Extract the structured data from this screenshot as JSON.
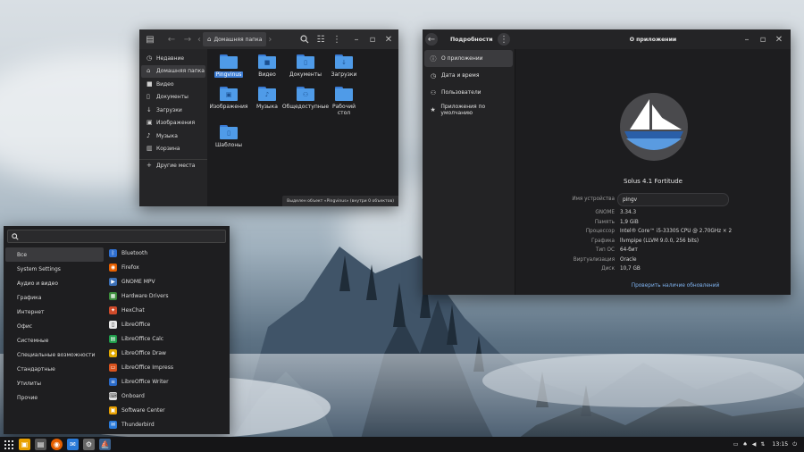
{
  "file_manager": {
    "path_label": "Домашняя папка",
    "sidebar": [
      {
        "icon": "clock-icon",
        "label": "Недавние"
      },
      {
        "icon": "home-icon",
        "label": "Домашняя папка"
      },
      {
        "icon": "video-icon",
        "label": "Видео"
      },
      {
        "icon": "document-icon",
        "label": "Документы"
      },
      {
        "icon": "download-icon",
        "label": "Загрузки"
      },
      {
        "icon": "image-icon",
        "label": "Изображения"
      },
      {
        "icon": "music-icon",
        "label": "Музыка"
      },
      {
        "icon": "trash-icon",
        "label": "Корзина"
      },
      {
        "icon": "plus-icon",
        "label": "Другие места"
      }
    ],
    "folders": [
      {
        "label": "Pingvinus",
        "icon": "folder-icon"
      },
      {
        "label": "Видео",
        "icon": "folder-video-icon"
      },
      {
        "label": "Документы",
        "icon": "folder-document-icon"
      },
      {
        "label": "Загрузки",
        "icon": "folder-download-icon"
      },
      {
        "label": "Изображения",
        "icon": "folder-image-icon"
      },
      {
        "label": "Музыка",
        "icon": "folder-music-icon"
      },
      {
        "label": "Общедоступные",
        "icon": "folder-public-icon"
      },
      {
        "label": "Рабочий стол",
        "icon": "folder-desktop-icon"
      },
      {
        "label": "Шаблоны",
        "icon": "folder-templates-icon"
      }
    ],
    "status": "Выделен объект «Pingvinus» (внутри 0 объектов)"
  },
  "about": {
    "sidebar_title": "Подробности",
    "title": "О приложении",
    "sidebar": [
      {
        "icon": "info-icon",
        "label": "О приложении"
      },
      {
        "icon": "clock-icon",
        "label": "Дата и время"
      },
      {
        "icon": "users-icon",
        "label": "Пользователи"
      },
      {
        "icon": "star-icon",
        "label": "Приложения по умолчанию"
      }
    ],
    "os_name": "Solus 4.1 Fortitude",
    "device_label": "Имя устройства",
    "device_value": "pingv",
    "details": [
      {
        "key": "GNOME",
        "value": "3.34.3"
      },
      {
        "key": "Память",
        "value": "1,9 GiB"
      },
      {
        "key": "Процессор",
        "value": "Intel® Core™ i5-3330S CPU @ 2.70GHz × 2"
      },
      {
        "key": "Графика",
        "value": "llvmpipe (LLVM 9.0.0, 256 bits)"
      },
      {
        "key": "Тип ОС",
        "value": "64-бит"
      },
      {
        "key": "Виртуализация",
        "value": "Oracle"
      },
      {
        "key": "Диск",
        "value": "10,7 GB"
      }
    ],
    "update_link": "Проверить наличие обновлений"
  },
  "menu": {
    "categories": [
      "Все",
      "System Settings",
      "Аудио и видео",
      "Графика",
      "Интернет",
      "Офис",
      "Системные",
      "Специальные возможности",
      "Стандартные",
      "Утилиты",
      "Прочие"
    ],
    "apps": [
      {
        "label": "Bluetooth",
        "icon": "bluetooth-icon",
        "color": "#2f6fd0",
        "glyph": "ᛒ"
      },
      {
        "label": "Firefox",
        "icon": "firefox-icon",
        "color": "#e66000",
        "glyph": "◉"
      },
      {
        "label": "GNOME MPV",
        "icon": "mpv-icon",
        "color": "#3b6fb6",
        "glyph": "▶"
      },
      {
        "label": "Hardware Drivers",
        "icon": "drivers-icon",
        "color": "#3c8d3c",
        "glyph": "▦"
      },
      {
        "label": "HexChat",
        "icon": "hexchat-icon",
        "color": "#d04b2a",
        "glyph": "✦"
      },
      {
        "label": "LibreOffice",
        "icon": "libreoffice-icon",
        "color": "#e8e8e8",
        "glyph": "▯"
      },
      {
        "label": "LibreOffice Calc",
        "icon": "calc-icon",
        "color": "#1f9c4a",
        "glyph": "▤"
      },
      {
        "label": "LibreOffice Draw",
        "icon": "draw-icon",
        "color": "#e0a800",
        "glyph": "◆"
      },
      {
        "label": "LibreOffice Impress",
        "icon": "impress-icon",
        "color": "#d9531e",
        "glyph": "▭"
      },
      {
        "label": "LibreOffice Writer",
        "icon": "writer-icon",
        "color": "#2a6ac8",
        "glyph": "≡"
      },
      {
        "label": "Onboard",
        "icon": "keyboard-icon",
        "color": "#e0e0e0",
        "glyph": "⌨"
      },
      {
        "label": "Software Center",
        "icon": "software-center-icon",
        "color": "#e8a000",
        "glyph": "▣"
      },
      {
        "label": "Thunderbird",
        "icon": "thunderbird-icon",
        "color": "#2a7ad8",
        "glyph": "✉"
      }
    ]
  },
  "taskbar": {
    "time": "13:15"
  }
}
